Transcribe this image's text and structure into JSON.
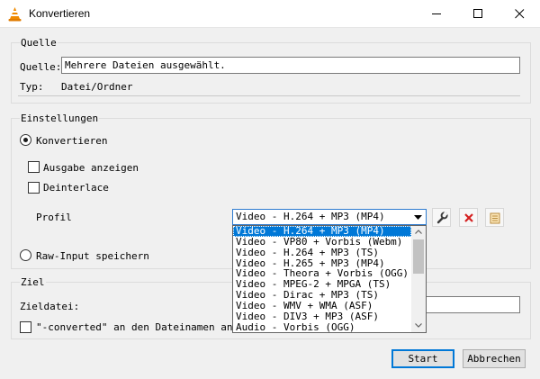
{
  "window": {
    "title": "Konvertieren"
  },
  "source": {
    "group_label": "Quelle",
    "field_label": "Quelle:",
    "field_value": "Mehrere Dateien ausgewählt.",
    "type_label": "Typ:",
    "type_value": "Datei/Ordner"
  },
  "settings": {
    "group_label": "Einstellungen",
    "convert_label": "Konvertieren",
    "convert_selected": true,
    "show_output_label": "Ausgabe anzeigen",
    "show_output_checked": false,
    "deinterlace_label": "Deinterlace",
    "deinterlace_checked": false,
    "profile_label": "Profil",
    "profile_selected": "Video - H.264 + MP3 (MP4)",
    "profile_options": [
      "Video - H.264 + MP3 (MP4)",
      "Video - VP80 + Vorbis (Webm)",
      "Video - H.264 + MP3 (TS)",
      "Video - H.265 + MP3 (MP4)",
      "Video - Theora + Vorbis (OGG)",
      "Video - MPEG-2 + MPGA (TS)",
      "Video - Dirac + MP3 (TS)",
      "Video - WMV + WMA (ASF)",
      "Video - DIV3 + MP3 (ASF)",
      "Audio - Vorbis (OGG)"
    ],
    "raw_input_label": "Raw-Input speichern",
    "raw_input_selected": false
  },
  "target": {
    "group_label": "Ziel",
    "file_label": "Zieldatei:",
    "file_value": "",
    "append_label": "\"-converted\" an den Dateinamen anhäng",
    "append_checked": false
  },
  "buttons": {
    "start": "Start",
    "cancel": "Abbrechen"
  },
  "colors": {
    "accent": "#0078d7",
    "selection": "#0078d7",
    "delete_red": "#d42020"
  }
}
